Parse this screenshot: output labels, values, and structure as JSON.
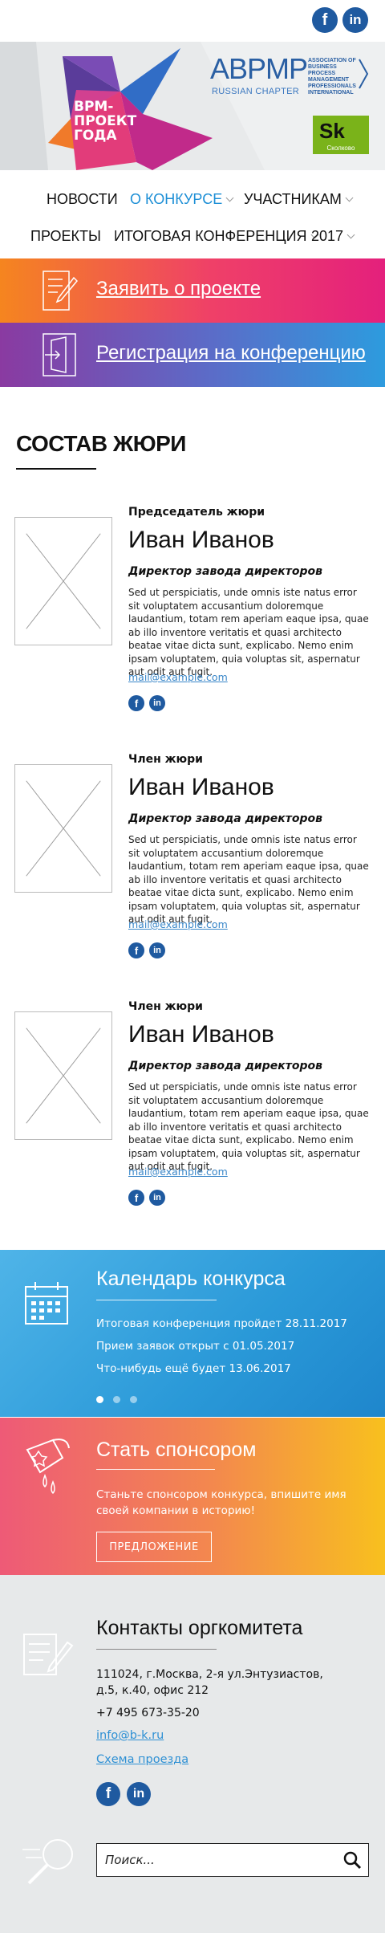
{
  "social": {
    "facebook": "f",
    "linkedin": "in"
  },
  "header": {
    "logo_title": "BPM-проект года",
    "partner": {
      "main": "ABPMP",
      "sub": "RUSSIAN CHAPTER",
      "assoc": "Association of Business Process Management Professionals International"
    },
    "skolkovo": {
      "mark": "Sk",
      "name": "Сколково"
    }
  },
  "nav": {
    "items": [
      {
        "label": "Новости"
      },
      {
        "label": "О конкурсе",
        "active": true
      },
      {
        "label": "Участникам"
      },
      {
        "label": "Проекты"
      },
      {
        "label": "Итоговая конференция"
      },
      {
        "label": "2017"
      }
    ]
  },
  "cta": {
    "apply": "Заявить о проекте",
    "register": "Регистрация на конференцию"
  },
  "jury": {
    "title": "Состав жюри",
    "members": [
      {
        "role": "Председатель жюри",
        "name": "Иван Иванов",
        "position": "Директор завода директоров",
        "bio": "Sed ut perspiciatis, unde omnis iste natus error sit voluptatem accusantium doloremque laudantium, totam rem aperiam eaque ipsa, quae ab illo inventore veritatis et quasi architecto beatae vitae dicta sunt, explicabo. Nemo enim ipsam voluptatem, quia voluptas sit, aspernatur aut odit aut fugit.",
        "email": "mail@example.com"
      },
      {
        "role": "Член жюри",
        "name": "Иван Иванов",
        "position": "Директор завода директоров",
        "bio": "Sed ut perspiciatis, unde omnis iste natus error sit voluptatem accusantium doloremque laudantium, totam rem aperiam eaque ipsa, quae ab illo inventore veritatis et quasi architecto beatae vitae dicta sunt, explicabo. Nemo enim ipsam voluptatem, quia voluptas sit, aspernatur aut odit aut fugit.",
        "email": "mail@example.com"
      },
      {
        "role": "Член жюри",
        "name": "Иван Иванов",
        "position": "Директор завода директоров",
        "bio": "Sed ut perspiciatis, unde omnis iste natus error sit voluptatem accusantium doloremque laudantium, totam rem aperiam eaque ipsa, quae ab illo inventore veritatis et quasi architecto beatae vitae dicta sunt, explicabo. Nemo enim ipsam voluptatem, quia voluptas sit, aspernatur aut odit aut fugit.",
        "email": "mail@example.com"
      }
    ]
  },
  "calendar": {
    "title": "Календарь конкурса",
    "events": [
      "Итоговая конференция пройдет 28.11.2017",
      "Прием заявок открыт с 01.05.2017",
      "Что-нибудь ещё будет 13.06.2017"
    ]
  },
  "sponsor": {
    "title": "Стать спонсором",
    "text": "Станьте спонсором конкурса, впишите имя своей компании в историю!",
    "button": "Предложение"
  },
  "contacts": {
    "title": "Контакты оргкомитета",
    "address_line1": "111024, г.Москва, 2-я ул.Энтузиастов,",
    "address_line2": "д.5, к.40, офис 212",
    "phone": "+7 495 673-35-20",
    "email": "info@b-k.ru",
    "map_link": "Схема проезда"
  },
  "search": {
    "placeholder": "Поиск..."
  },
  "colors": {
    "accent": "#1d8fd6",
    "facebook": "#1f5aa0",
    "link": "#2e90d4"
  }
}
